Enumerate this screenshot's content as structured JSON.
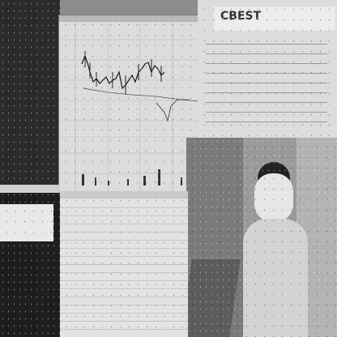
{
  "logo": "CBEST",
  "chart_title": "",
  "left_panel": {
    "top_lines": [
      "",
      "",
      "",
      "",
      "",
      ""
    ],
    "bottom_label_1": "",
    "bottom_label_2": ""
  },
  "banner_lines": [
    "",
    "",
    ""
  ],
  "colors": {
    "panel_light": "#dcdcdc",
    "panel_dark": "#2b2b2b",
    "chart_line": "#1a1a1a"
  }
}
